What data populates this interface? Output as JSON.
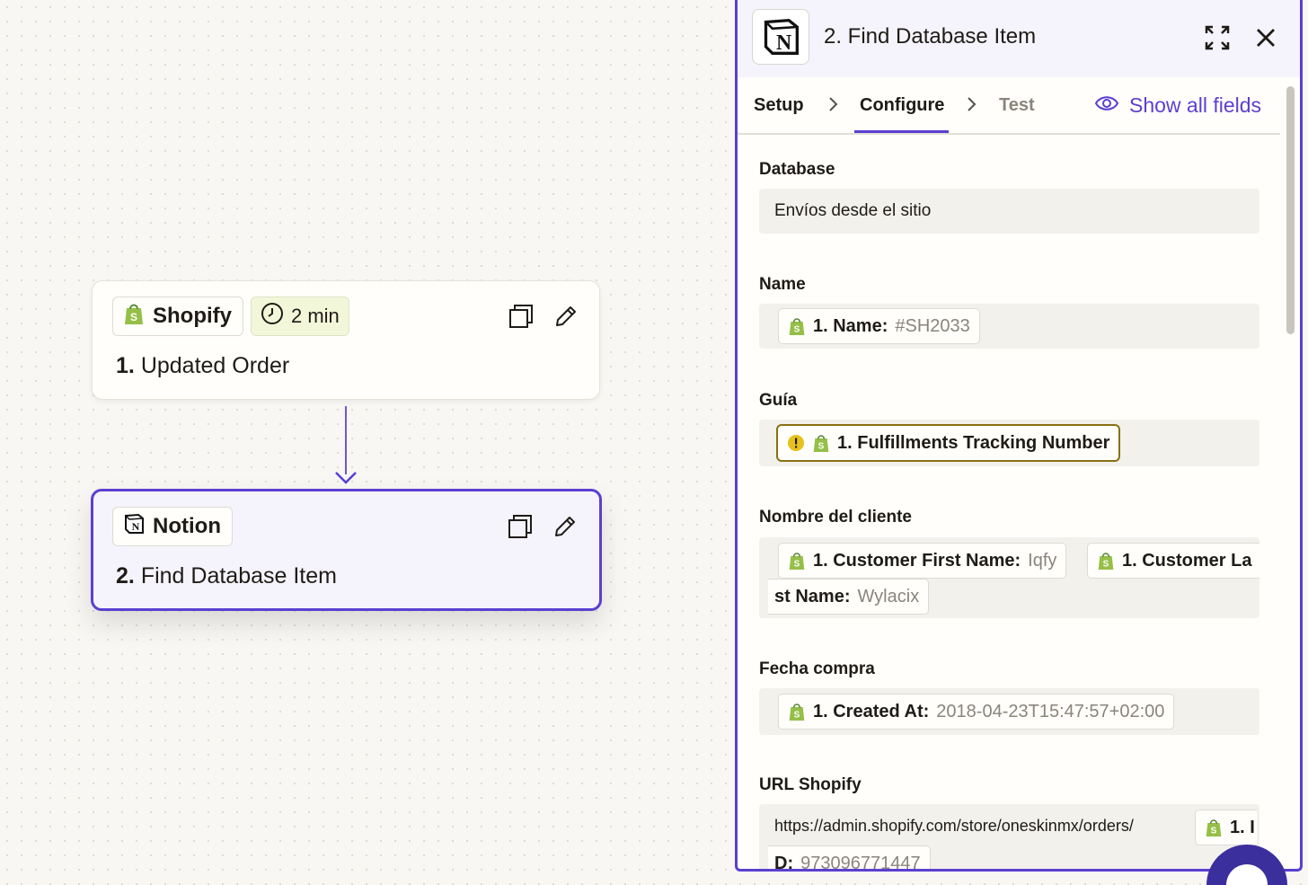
{
  "canvas": {
    "step1": {
      "app_name": "Shopify",
      "app_icon": "shopify-bag-icon",
      "delay_label": "2 min",
      "number": "1.",
      "title": "Updated Order"
    },
    "step2": {
      "app_name": "Notion",
      "app_icon": "notion-icon",
      "number": "2.",
      "title": "Find Database Item"
    }
  },
  "panel": {
    "title": "2. Find Database Item",
    "app_icon": "notion-icon",
    "tabs": [
      {
        "label": "Setup",
        "state": "default"
      },
      {
        "label": "Configure",
        "state": "active"
      },
      {
        "label": "Test",
        "state": "disabled"
      }
    ],
    "show_all_label": "Show all fields",
    "fields": {
      "database": {
        "label": "Database",
        "value": "Envíos desde el sitio"
      },
      "name": {
        "label": "Name",
        "pill_key": "1. Name:",
        "pill_value": "#SH2033"
      },
      "guia": {
        "label": "Guía",
        "pill_key": "1. Fulfillments Tracking Number",
        "warning": true
      },
      "nombre_cliente": {
        "label": "Nombre del cliente",
        "pill1_key": "1. Customer First Name:",
        "pill1_value": "Iqfy",
        "pill2_key_part1": "1. Customer La",
        "pill2_key_part2": "st Name:",
        "pill2_value": "Wylacix"
      },
      "fecha_compra": {
        "label": "Fecha compra",
        "pill_key": "1. Created At:",
        "pill_value": "2018-04-23T15:47:57+02:00"
      },
      "url_shopify": {
        "label": "URL Shopify",
        "prefix": "https://admin.shopify.com/store/oneskinmx/orders/",
        "pill_key_part1": "1. I",
        "pill_key_part2": "D:",
        "pill_value": "973096771447"
      }
    }
  },
  "colors": {
    "accent": "#5b3fd1",
    "shopify_green": "#95bf47",
    "canvas_bg": "#f8f7f3",
    "warning": "#e8c21b"
  }
}
